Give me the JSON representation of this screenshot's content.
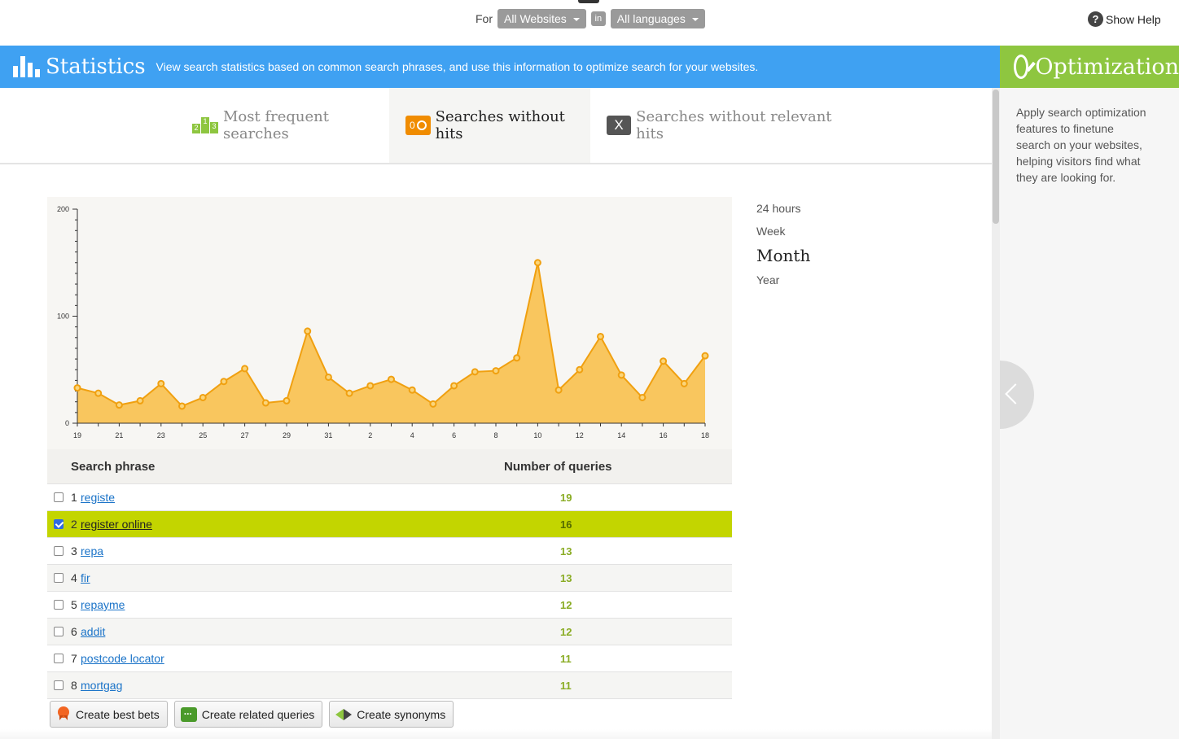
{
  "topbar": {
    "for_label": "For",
    "website_select": "All Websites",
    "in_label": "in",
    "language_select": "All languages",
    "help_label": "Show Help",
    "help_glyph": "?"
  },
  "statistics": {
    "title": "Statistics",
    "description": "View search statistics based on common search phrases, and use this information to optimize search for your websites."
  },
  "optimization": {
    "title": "Optimization",
    "description": "Apply search optimization features to finetune search on your websites, helping visitors find what they are looking for."
  },
  "tabs": [
    {
      "label": "Most frequent searches",
      "icon": "podium-icon",
      "icon_text": [
        "2",
        "1",
        "3"
      ]
    },
    {
      "label": "Searches without hits",
      "icon": "zero-hits-icon",
      "icon_text": "0",
      "active": true
    },
    {
      "label": "Searches without relevant hits",
      "icon": "x-icon",
      "icon_text": "X"
    }
  ],
  "periods": [
    {
      "label": "24 hours",
      "active": false
    },
    {
      "label": "Week",
      "active": false
    },
    {
      "label": "Month",
      "active": true
    },
    {
      "label": "Year",
      "active": false
    }
  ],
  "chart_data": {
    "type": "area",
    "x": [
      "19",
      "20",
      "21",
      "22",
      "23",
      "24",
      "25",
      "26",
      "27",
      "28",
      "29",
      "30",
      "31",
      "1",
      "2",
      "3",
      "4",
      "5",
      "6",
      "7",
      "8",
      "9",
      "10",
      "11",
      "12",
      "13",
      "14",
      "15",
      "16",
      "17",
      "18"
    ],
    "x_tick_labels": [
      "19",
      "21",
      "23",
      "25",
      "27",
      "29",
      "31",
      "2",
      "4",
      "6",
      "8",
      "10",
      "12",
      "14",
      "16",
      "18"
    ],
    "y_ticks": [
      0,
      100,
      200
    ],
    "ylim": [
      0,
      200
    ],
    "series": [
      {
        "values": [
          33,
          28,
          17,
          21,
          37,
          16,
          24,
          39,
          51,
          19,
          21,
          86,
          43,
          28,
          35,
          41,
          31,
          18,
          35,
          48,
          49,
          61,
          150,
          31,
          50,
          81,
          45,
          24,
          58,
          37,
          63
        ]
      }
    ],
    "colors": {
      "fill": "#f9c65e",
      "line": "#f0a010",
      "marker": "#f0a010"
    }
  },
  "table": {
    "headers": {
      "phrase": "Search phrase",
      "count": "Number of queries"
    },
    "rows": [
      {
        "n": "1",
        "phrase": "registe",
        "count": "19",
        "checked": false
      },
      {
        "n": "2",
        "phrase": "register online",
        "count": "16",
        "checked": true
      },
      {
        "n": "3",
        "phrase": "repa",
        "count": "13",
        "checked": false
      },
      {
        "n": "4",
        "phrase": "fir",
        "count": "13",
        "checked": false
      },
      {
        "n": "5",
        "phrase": "repayme",
        "count": "12",
        "checked": false
      },
      {
        "n": "6",
        "phrase": "addit",
        "count": "12",
        "checked": false
      },
      {
        "n": "7",
        "phrase": "postcode locator",
        "count": "11",
        "checked": false
      },
      {
        "n": "8",
        "phrase": "mortgag",
        "count": "11",
        "checked": false
      }
    ]
  },
  "actions": {
    "best_bets": "Create best bets",
    "related": "Create related queries",
    "synonyms": "Create synonyms"
  }
}
